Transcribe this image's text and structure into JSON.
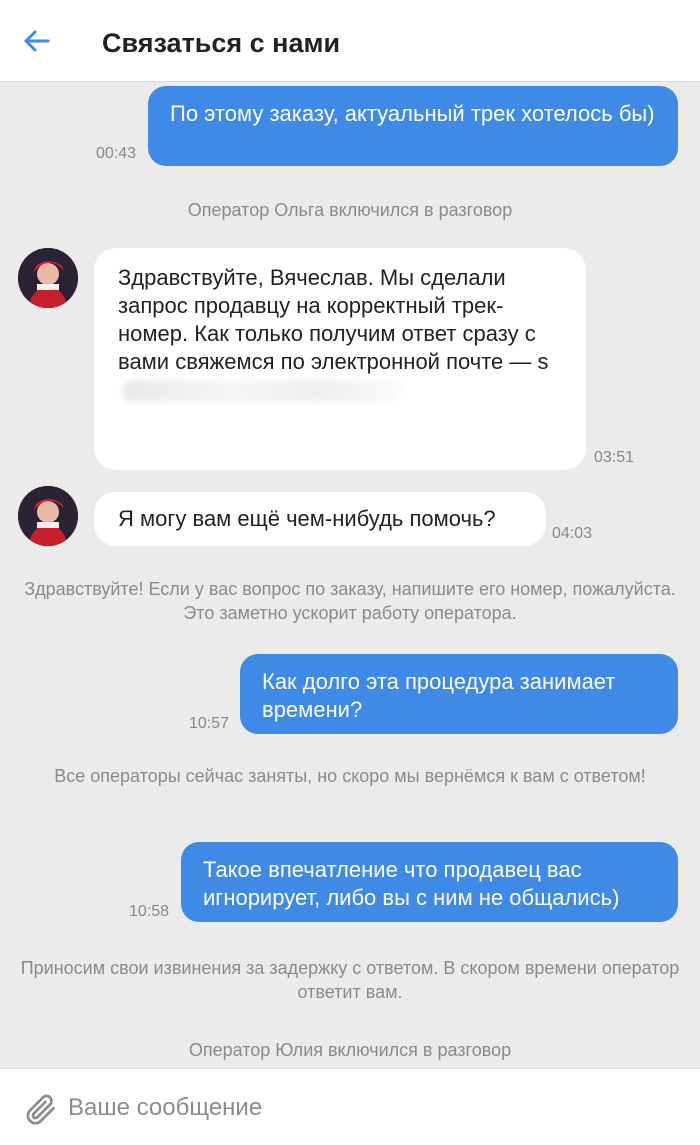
{
  "header": {
    "title": "Связаться с нами",
    "back_icon": "arrow-left-icon"
  },
  "colors": {
    "accent": "#3f8ae6",
    "background": "#ebebeb",
    "system_text": "#8a8a8a"
  },
  "messages": [
    {
      "type": "outgoing",
      "text": "По этому заказу, актуальный трек хотелось бы)",
      "time": "00:43"
    },
    {
      "type": "system",
      "text": "Оператор Ольга включился в разговор"
    },
    {
      "type": "incoming",
      "text": "Здравствуйте, Вячеслав. Мы сделали запрос продавцу на корректный трек-номер. Как только получим ответ сразу с вами свяжемся по электронной почте — s",
      "time": "03:51"
    },
    {
      "type": "incoming",
      "text": "Я могу вам ещё чем-нибудь помочь?",
      "time": "04:03"
    },
    {
      "type": "system",
      "text": "Здравствуйте! Если у вас вопрос по заказу, напишите его номер, пожалуйста. Это заметно ускорит работу оператора."
    },
    {
      "type": "outgoing",
      "text": "Как долго эта процедура занимает времени?",
      "time": "10:57"
    },
    {
      "type": "system",
      "text": "Все операторы сейчас заняты, но скоро мы вернёмся к вам с ответом!"
    },
    {
      "type": "outgoing",
      "text": "Такое впечатление что продавец вас игнорирует, либо вы с ним не общались)",
      "time": "10:58"
    },
    {
      "type": "system",
      "text": "Приносим свои извинения за задержку с ответом. В скором времени оператор ответит вам."
    },
    {
      "type": "system",
      "text": "Оператор Юлия включился в разговор"
    }
  ],
  "composer": {
    "placeholder": "Ваше сообщение",
    "attach_icon": "paperclip-icon"
  }
}
